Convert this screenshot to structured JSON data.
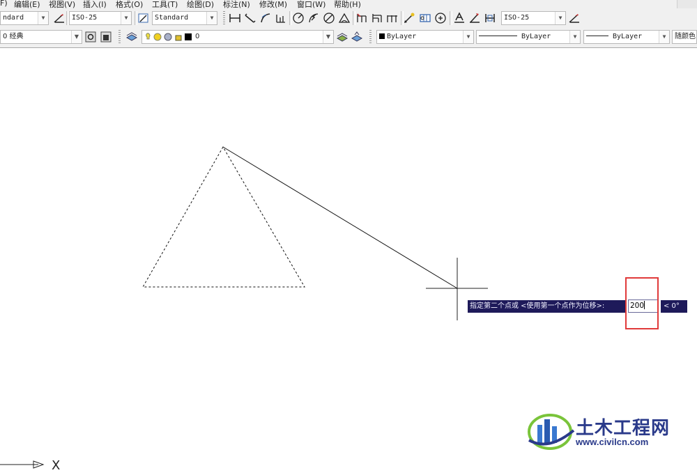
{
  "menubar": {
    "items": [
      "F)",
      "编辑(E)",
      "视图(V)",
      "插入(I)",
      "格式(O)",
      "工具(T)",
      "绘图(D)",
      "标注(N)",
      "修改(M)",
      "窗口(W)",
      "帮助(H)"
    ]
  },
  "toolbar_row1": {
    "text_style": "ndard",
    "dim_style": "ISO-25",
    "table_style": "Standard",
    "mleader_style": "ISO-25"
  },
  "toolbar_row2": {
    "workspace": "0 经典",
    "layer_name": "0",
    "color": "ByLayer",
    "linetype": "ByLayer",
    "lineweight": "ByLayer",
    "plot_style": "随颜色",
    "layer_color": "#000000"
  },
  "command": {
    "prompt": "指定第二个点或 <使用第一个点作为位移>:",
    "input_value": "200",
    "angle": "< 0°"
  },
  "ucs": {
    "x_label": "X"
  },
  "watermark": {
    "name": "土木工程网",
    "url": "www.civilcn.com"
  },
  "colors": {
    "prompt_bg": "#1e1a5a",
    "highlight": "#e03a3a",
    "logo_blue": "#2a3a8a",
    "logo_green": "#7ac43a"
  }
}
